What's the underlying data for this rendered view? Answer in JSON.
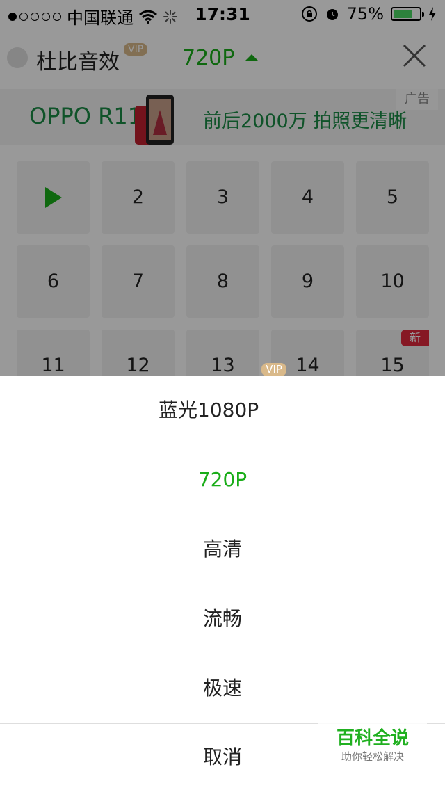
{
  "status_bar": {
    "carrier": "中国联通",
    "time": "17:31",
    "battery": "75%",
    "battery_level": 0.75,
    "signal_dots_filled": 1,
    "signal_dots_total": 5
  },
  "header": {
    "dolby_label": "杜比音效",
    "vip_badge": "VIP",
    "current_quality": "720P"
  },
  "ad": {
    "brand": "OPPO R11",
    "slogan": "前后2000万 拍照更清晰",
    "label": "广告"
  },
  "episodes": {
    "items": [
      "2",
      "3",
      "4",
      "5",
      "6",
      "7",
      "8",
      "9",
      "10",
      "11",
      "12",
      "13",
      "14",
      "15"
    ],
    "new_badge": "新"
  },
  "quality_sheet": {
    "options": [
      {
        "label": "蓝光1080P",
        "badge": "VIP"
      },
      {
        "label": "720P"
      },
      {
        "label": "高清"
      },
      {
        "label": "流畅"
      },
      {
        "label": "极速"
      }
    ],
    "cancel_label": "取消"
  },
  "watermark": {
    "title": "百科全说",
    "subtitle": "助你轻松解决"
  },
  "colors": {
    "accent_green": "#1aad19",
    "vip_gold": "#d9b98a",
    "new_red": "#e0283c",
    "ad_green": "#1a8a45"
  }
}
